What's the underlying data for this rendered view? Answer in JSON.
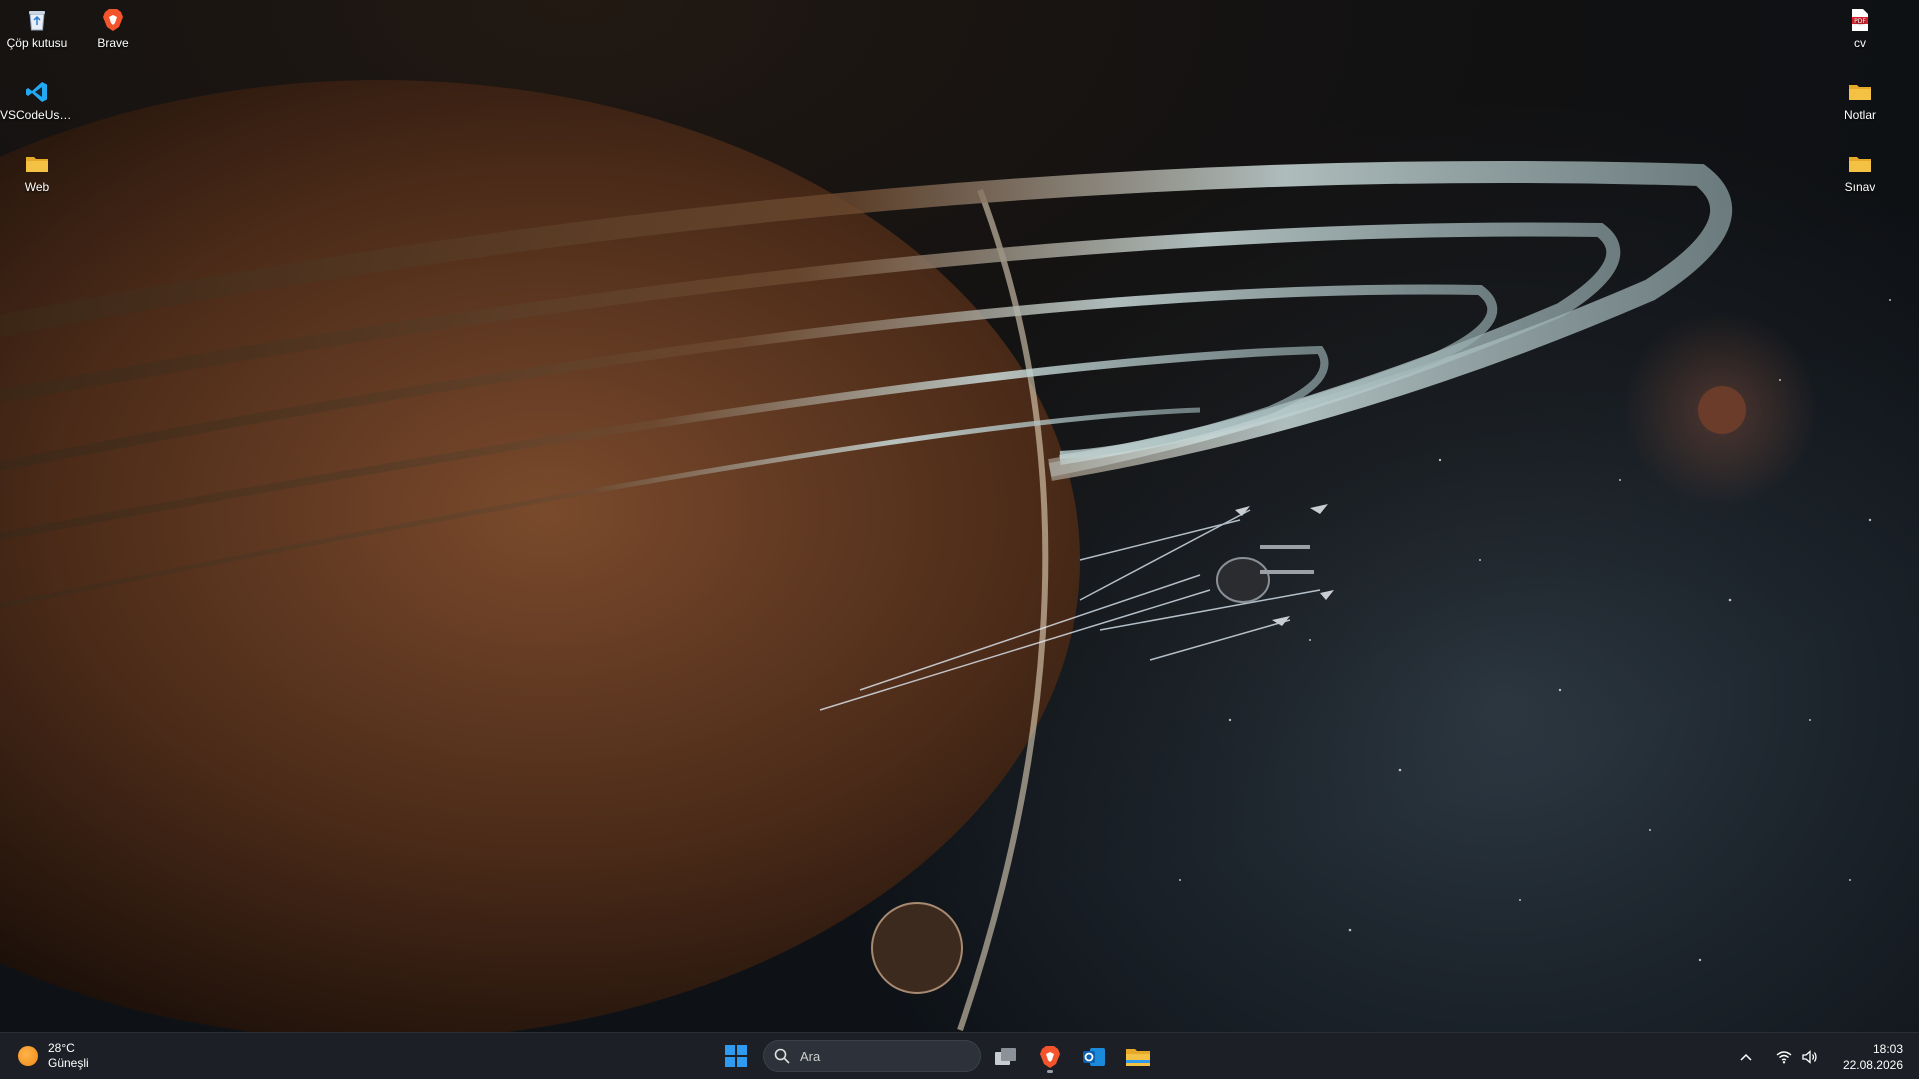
{
  "desktop": {
    "icons": [
      {
        "label": "Çöp kutusu",
        "icon": "recycle-bin-icon"
      },
      {
        "label": "Brave",
        "icon": "brave-icon"
      },
      {
        "label": "VSCodeUse...",
        "icon": "vscode-icon"
      },
      {
        "label": "Web",
        "icon": "folder-icon"
      },
      {
        "label": "cv",
        "icon": "pdf-icon"
      },
      {
        "label": "Notlar",
        "icon": "folder-icon"
      },
      {
        "label": "Sınav",
        "icon": "folder-icon"
      }
    ]
  },
  "taskbar": {
    "weather": {
      "temperature": "28°C",
      "condition": "Güneşli",
      "icon": "sun-icon"
    },
    "search": {
      "placeholder": "Ara"
    },
    "apps": [
      {
        "icon": "task-view-icon"
      },
      {
        "icon": "brave-icon"
      },
      {
        "icon": "outlook-icon"
      },
      {
        "icon": "file-explorer-icon"
      }
    ],
    "tray": {
      "time": "18:03",
      "date": "22.08.2026",
      "icons": [
        "chevron-up-icon",
        "wifi-icon",
        "volume-icon"
      ]
    }
  },
  "colors": {
    "taskbar_bg": "#1c2026",
    "folder_yellow": "#f3c244",
    "windows_blue": "#2f9bf0",
    "brave_orange": "#f4542b",
    "vscode_blue": "#23a9f2"
  }
}
